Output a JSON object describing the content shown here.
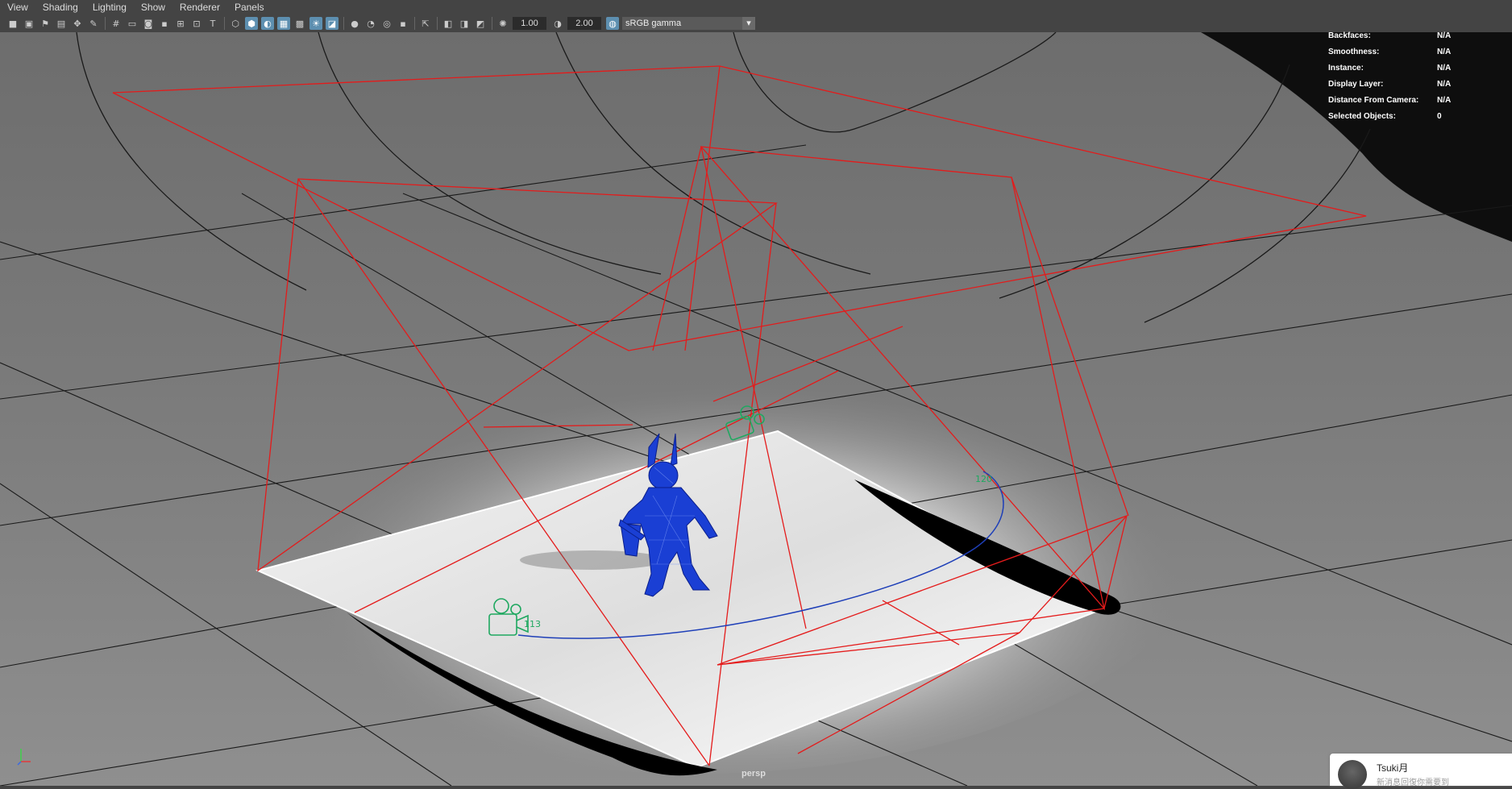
{
  "menu": [
    "View",
    "Shading",
    "Lighting",
    "Show",
    "Renderer",
    "Panels"
  ],
  "toolbar": {
    "exposure": "1.00",
    "gamma": "2.00",
    "color_management": "sRGB gamma"
  },
  "hud": {
    "rows": [
      {
        "label": "Backfaces:",
        "value": "N/A"
      },
      {
        "label": "Smoothness:",
        "value": "N/A"
      },
      {
        "label": "Instance:",
        "value": "N/A"
      },
      {
        "label": "Display Layer:",
        "value": "N/A"
      },
      {
        "label": "Distance From Camera:",
        "value": "N/A"
      },
      {
        "label": "Selected Objects:",
        "value": "0"
      }
    ]
  },
  "viewport": {
    "camera_name": "persp",
    "camera_label_a": "113",
    "camera_label_b": "120"
  },
  "notification": {
    "user": "Tsuki月",
    "message": "新消息回復你需要到"
  },
  "colors": {
    "light_wire": "#ff2020",
    "model_wire": "#1a3fd4",
    "camera_wire": "#1fa860",
    "path_curve": "#1e3fb8",
    "ui_bg": "#444444"
  }
}
